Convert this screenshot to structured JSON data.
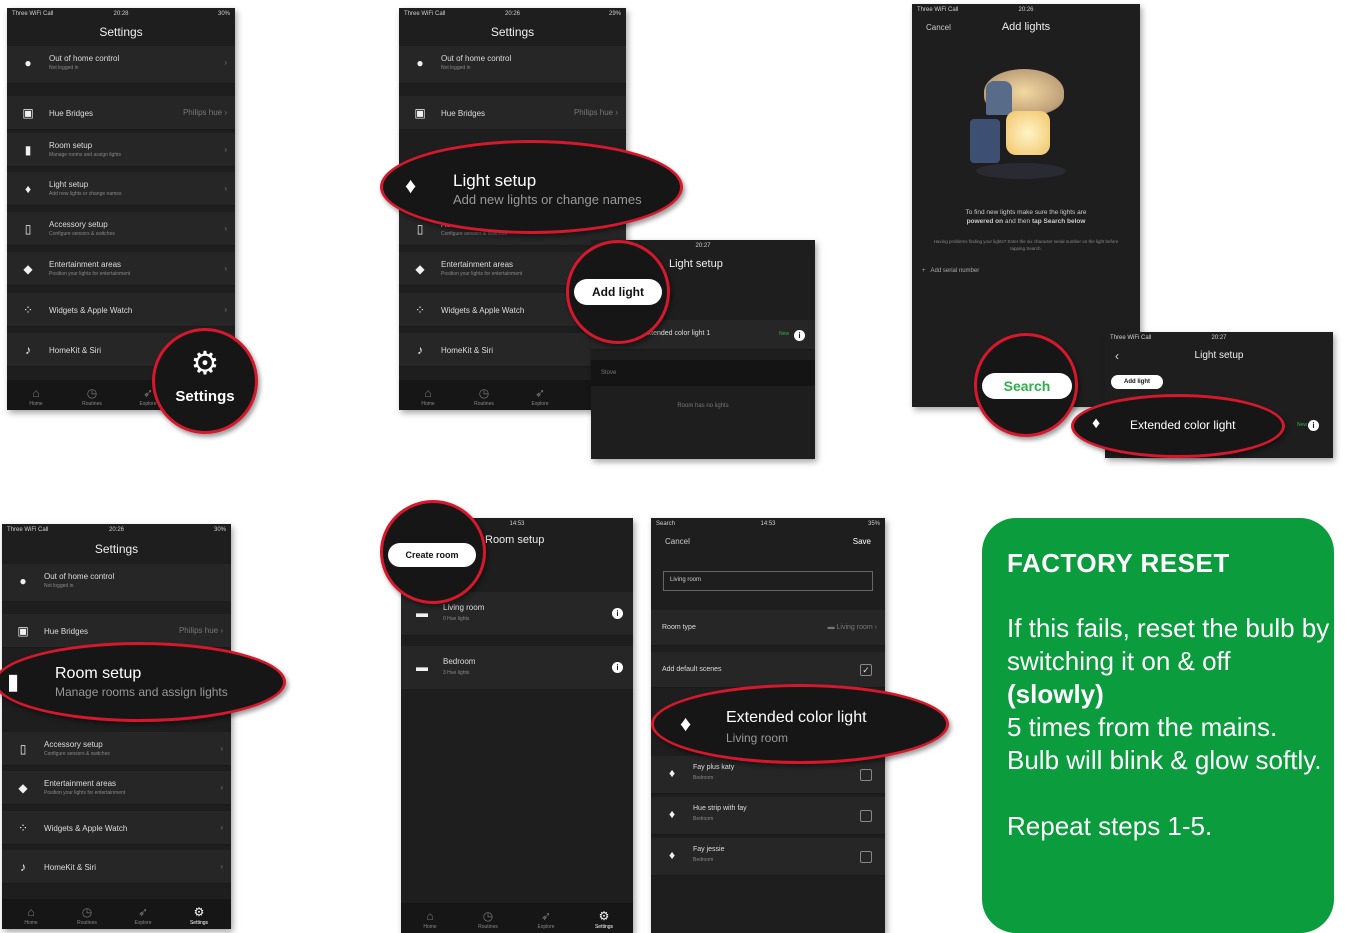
{
  "status": {
    "carrier": "Three WiFi Call",
    "carrier_alt": "Search",
    "time_a": "20:28",
    "time_b": "20:26",
    "time_c": "20:27",
    "time_d": "14:53",
    "battery_a": "30%",
    "battery_b": "29%",
    "battery_c": "35%"
  },
  "settings": {
    "title": "Settings",
    "rows": [
      {
        "label": "Out of home control",
        "sub": "Not logged in",
        "icon": "person-icon"
      },
      {
        "label": "Hue Bridges",
        "value": "Philips hue",
        "icon": "bridge-icon"
      },
      {
        "label": "Room setup",
        "sub": "Manage rooms and assign lights",
        "icon": "door-icon"
      },
      {
        "label": "Light setup",
        "sub": "Add new lights or change names",
        "icon": "bulb-icon"
      },
      {
        "label": "Accessory setup",
        "sub": "Configure sensors & switches",
        "icon": "switch-icon"
      },
      {
        "label": "Entertainment areas",
        "sub": "Position your lights for entertainment",
        "icon": "gamepad-icon"
      },
      {
        "label": "Widgets & Apple Watch",
        "icon": "widgets-icon"
      },
      {
        "label": "HomeKit & Siri",
        "icon": "mic-icon"
      }
    ],
    "tabs": [
      "Home",
      "Routines",
      "Explore",
      "Settings"
    ]
  },
  "zoom": {
    "settings": "Settings",
    "light_setup": "Light setup",
    "light_setup_sub": "Add new lights or change names",
    "add_light": "Add light",
    "room_setup": "Room setup",
    "room_setup_sub": "Manage rooms and assign lights",
    "create_room": "Create room",
    "search": "Search",
    "ext_light": "Extended color light",
    "ext_light_room": "Living room"
  },
  "light_setup_screen": {
    "title": "Light setup",
    "light": "Extended color light 1",
    "new": "New",
    "section": "Stove",
    "empty": "Room has no lights"
  },
  "add_lights": {
    "title": "Add lights",
    "cancel": "Cancel",
    "hint_a": "To find new lights make sure the lights are",
    "hint_b": "powered on",
    "hint_c": " and then ",
    "hint_d": "tap Search below",
    "problem": "Having problems finding your lights? Enter the six character serial number on the light before tapping Search.",
    "serial": "Add serial number"
  },
  "light_setup_small": {
    "title": "Light setup",
    "add": "Add light",
    "light": "Extended color light",
    "new": "New"
  },
  "room_setup": {
    "title": "Room setup",
    "rooms": [
      {
        "name": "Living room",
        "sub": "0 Hue lights"
      },
      {
        "name": "Bedroom",
        "sub": "3 Hue lights"
      }
    ]
  },
  "edit_room": {
    "cancel": "Cancel",
    "save": "Save",
    "name": "Living room",
    "type_label": "Room type",
    "type_value": "Living room",
    "default_scenes": "Add default scenes",
    "lights": [
      {
        "name": "Fay plus katy",
        "room": "Bedroom"
      },
      {
        "name": "Hue strip with fay",
        "room": "Bedroom"
      },
      {
        "name": "Fay jessie",
        "room": "Bedroom"
      }
    ]
  },
  "reset": {
    "title": "FACTORY RESET",
    "p1": "If this fails, reset the bulb by switching it on & off ",
    "bold": "(slowly)",
    "p2": "5 times from the mains. Bulb will blink & glow softly.",
    "p3": "Repeat steps 1-5."
  },
  "colors": {
    "ring": "#d6182c",
    "green": "#0b9c3d",
    "phone_bg": "#1e1e1f"
  }
}
